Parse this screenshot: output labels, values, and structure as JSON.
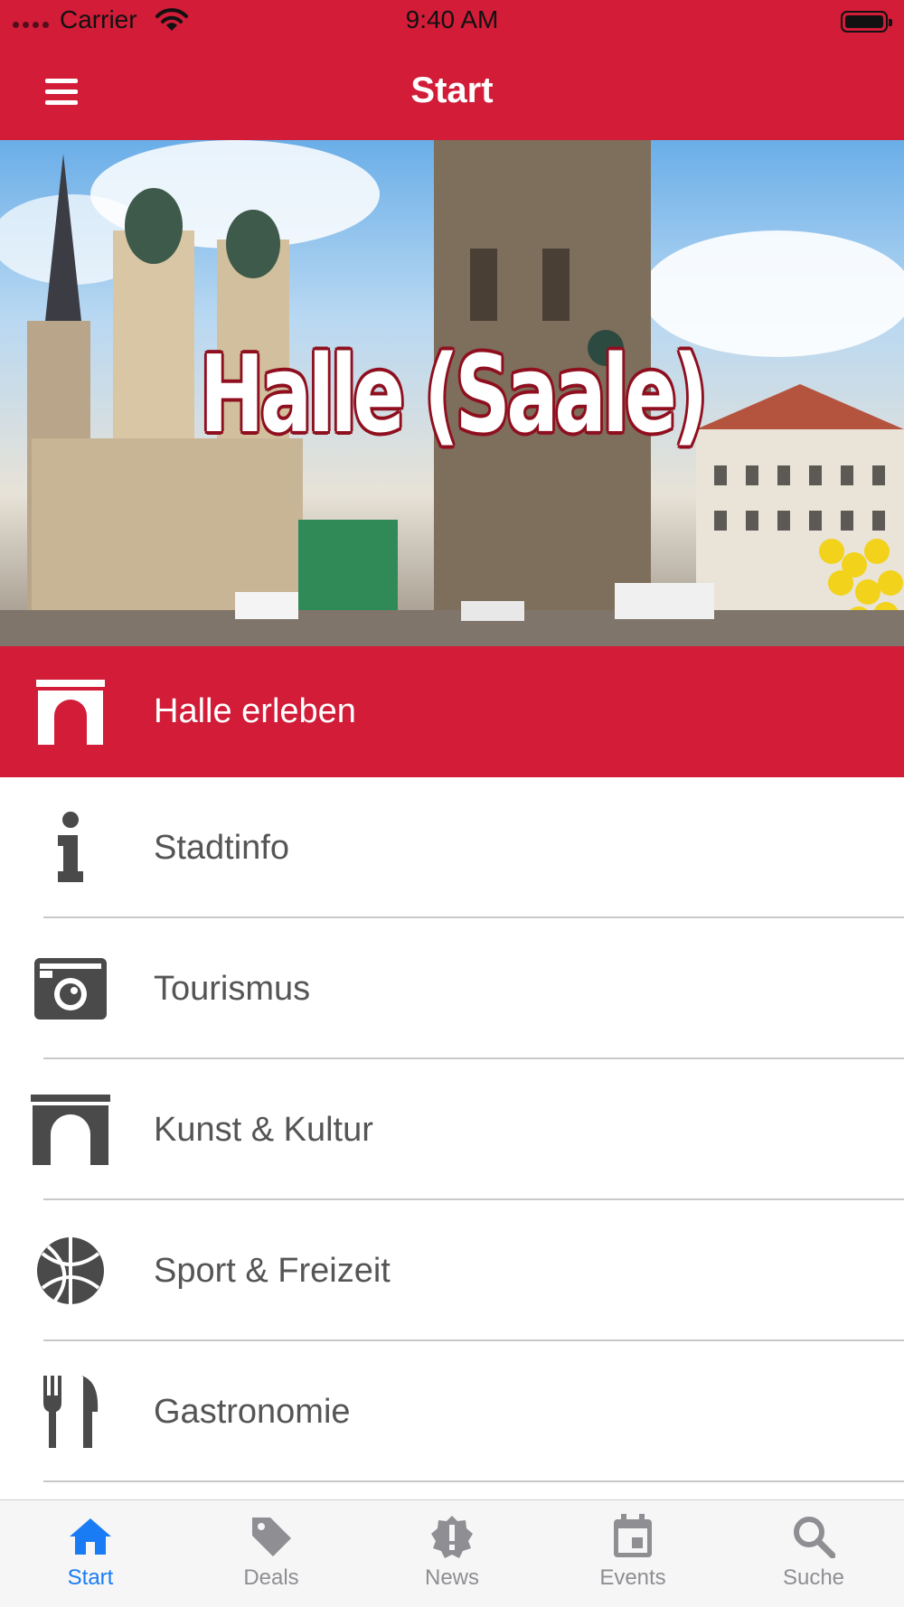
{
  "status_bar": {
    "carrier": "Carrier",
    "time": "9:40 AM",
    "wifi_icon": "wifi-icon",
    "battery_icon": "battery-icon",
    "battery_level": 1.0
  },
  "nav_bar": {
    "title": "Start",
    "menu_icon": "hamburger-menu-icon"
  },
  "hero": {
    "title": "Halle (Saale)"
  },
  "list": {
    "items": [
      {
        "label": "Halle erleben",
        "icon": "archway-icon",
        "highlighted": true
      },
      {
        "label": "Stadtinfo",
        "icon": "info-icon"
      },
      {
        "label": "Tourismus",
        "icon": "camera-icon"
      },
      {
        "label": "Kunst & Kultur",
        "icon": "archway-icon"
      },
      {
        "label": "Sport & Freizeit",
        "icon": "basketball-icon"
      },
      {
        "label": "Gastronomie",
        "icon": "fork-knife-icon"
      }
    ]
  },
  "tab_bar": {
    "tabs": [
      {
        "label": "Start",
        "icon": "home-icon",
        "active": true
      },
      {
        "label": "Deals",
        "icon": "tag-icon"
      },
      {
        "label": "News",
        "icon": "alert-badge-icon"
      },
      {
        "label": "Events",
        "icon": "calendar-icon"
      },
      {
        "label": "Suche",
        "icon": "search-icon"
      }
    ]
  },
  "colors": {
    "brand_red": "#d21c38",
    "active_tab_blue": "#1a7cf5",
    "inactive_gray": "#8e8e93",
    "row_text_gray": "#555555"
  }
}
